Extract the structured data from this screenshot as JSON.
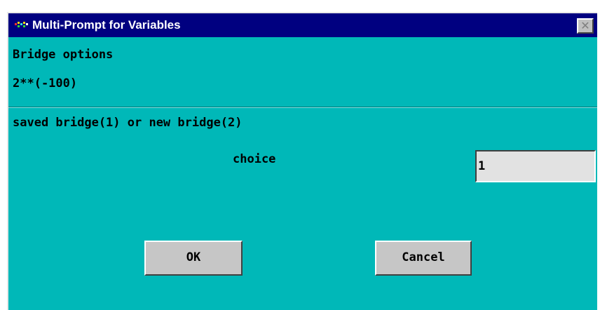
{
  "window": {
    "title": "Multi-Prompt for Variables",
    "close_glyph": "✕",
    "icon": "app-icon"
  },
  "header": {
    "heading": "Bridge options",
    "subheading": "2**(-100)"
  },
  "prompt": {
    "question": "saved bridge(1) or new bridge(2)",
    "field_label": "choice",
    "field_value": "1"
  },
  "buttons": {
    "ok_label": "OK",
    "cancel_label": "Cancel"
  },
  "colors": {
    "title_bar": "#000080",
    "dialog_background": "#00b8b8",
    "button_face": "#c6c6c6",
    "input_background": "#e2e2e2"
  }
}
